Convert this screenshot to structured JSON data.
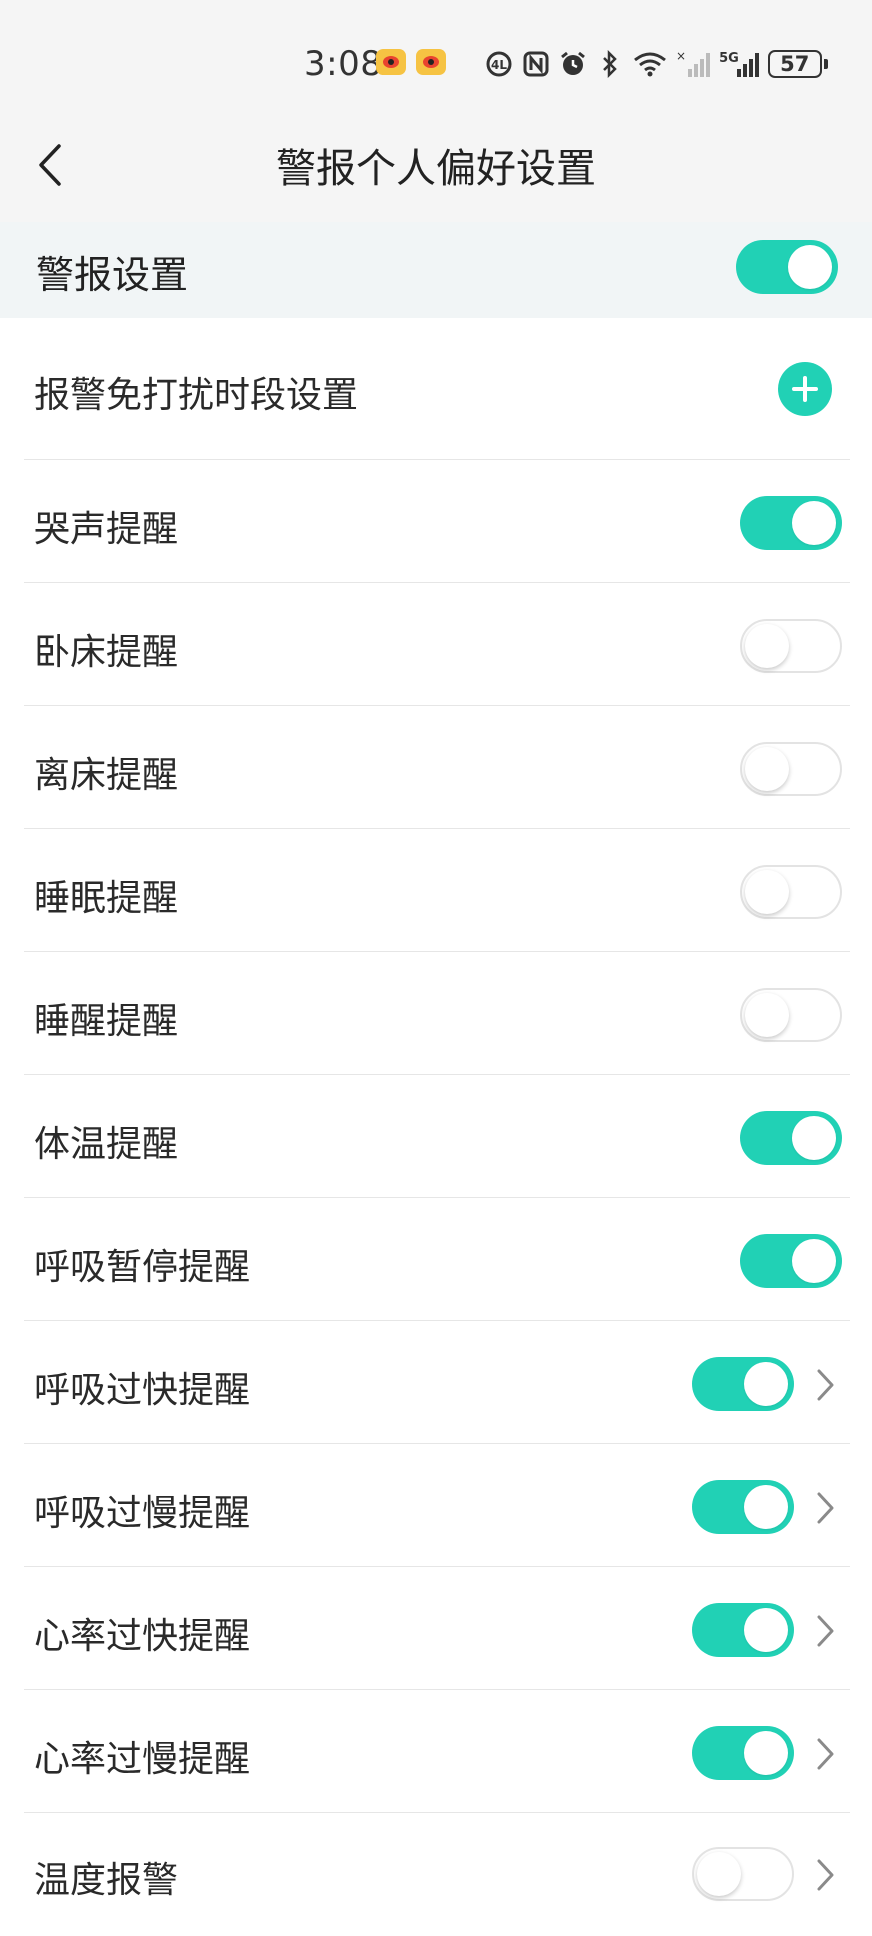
{
  "status_bar": {
    "time": "3:08",
    "battery": "57",
    "network": "5G"
  },
  "header": {
    "title": "警报个人偏好设置"
  },
  "master": {
    "label": "警报设置",
    "enabled": true
  },
  "dnd": {
    "label": "报警免打扰时段设置"
  },
  "alerts": [
    {
      "label": "哭声提醒",
      "enabled": true,
      "has_detail": false
    },
    {
      "label": "卧床提醒",
      "enabled": false,
      "has_detail": false
    },
    {
      "label": "离床提醒",
      "enabled": false,
      "has_detail": false
    },
    {
      "label": "睡眠提醒",
      "enabled": false,
      "has_detail": false
    },
    {
      "label": "睡醒提醒",
      "enabled": false,
      "has_detail": false
    },
    {
      "label": "体温提醒",
      "enabled": true,
      "has_detail": false
    },
    {
      "label": "呼吸暂停提醒",
      "enabled": true,
      "has_detail": false
    },
    {
      "label": "呼吸过快提醒",
      "enabled": true,
      "has_detail": true
    },
    {
      "label": "呼吸过慢提醒",
      "enabled": true,
      "has_detail": true
    },
    {
      "label": "心率过快提醒",
      "enabled": true,
      "has_detail": true
    },
    {
      "label": "心率过慢提醒",
      "enabled": true,
      "has_detail": true
    },
    {
      "label": "温度报警",
      "enabled": false,
      "has_detail": true
    }
  ],
  "colors": {
    "accent": "#21d1b5",
    "header_bg": "#f5f5f5",
    "master_bg": "#f1f5f6",
    "divider": "#e6e6e6"
  }
}
